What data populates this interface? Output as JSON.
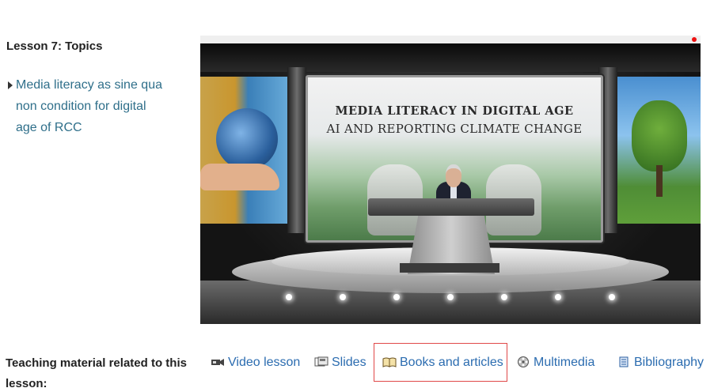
{
  "sidebar": {
    "heading": "Lesson 7: Topics",
    "topics": [
      {
        "label": "Media literacy as sine qua non condition for digital age of RCC"
      }
    ]
  },
  "video": {
    "screen_title_line1": "MEDIA LITERACY IN DIGITAL AGE",
    "screen_title_line2": "AI AND REPORTING CLIMATE CHANGE"
  },
  "material": {
    "label": "Teaching material related to this lesson:",
    "links": [
      {
        "label": "Video lesson",
        "icon": "video-camera-icon"
      },
      {
        "label": "Slides",
        "icon": "slides-icon"
      },
      {
        "label": "Books and articles",
        "icon": "open-book-icon",
        "highlighted": true
      },
      {
        "label": "Multimedia",
        "icon": "film-reel-icon"
      },
      {
        "label": "Bibliography",
        "icon": "bibliography-icon"
      }
    ],
    "highlight_color": "#e04848",
    "link_color": "#2b6cb0"
  },
  "colors": {
    "topic_link": "#2f6f8a",
    "text": "#222222"
  }
}
